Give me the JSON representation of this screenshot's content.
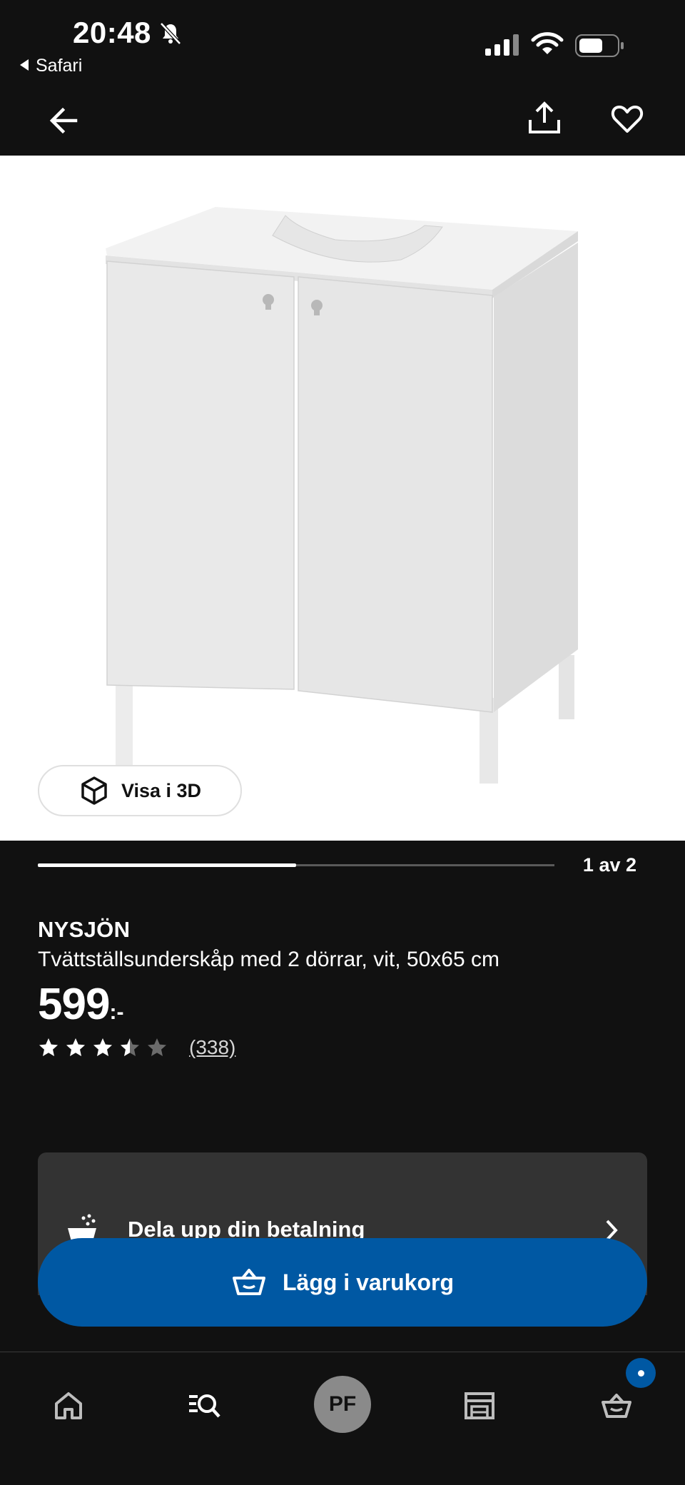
{
  "status_bar": {
    "time": "20:48",
    "back_app": "Safari",
    "icons": [
      "bell-muted-icon",
      "signal-icon",
      "wifi-icon",
      "battery-icon"
    ]
  },
  "nav_bar": {
    "icons": [
      "back-arrow-icon",
      "share-icon",
      "heart-icon"
    ]
  },
  "gallery": {
    "view_3d_label": "Visa i 3D",
    "pager_label": "1 av 2",
    "progress": 0.5
  },
  "product": {
    "brand": "NYSJÖN",
    "description": "Tvättställsunderskåp med 2 dörrar, vit, 50x65 cm",
    "price": "599",
    "price_suffix": ":-",
    "rating": 3.5,
    "rating_max": 5,
    "review_count": "(338)"
  },
  "payment_card": {
    "label": "Dela upp din betalning"
  },
  "cart_button": {
    "label": "Lägg i varukorg"
  },
  "tab_bar": {
    "avatar_initials": "PF",
    "tabs": [
      "home-icon",
      "search-icon",
      "profile-avatar",
      "stores-icon",
      "cart-icon"
    ]
  },
  "colors": {
    "background": "#111111",
    "primary_blue": "#0058a3",
    "card_gray": "#333333",
    "avatar_gray": "#8a8a8a"
  }
}
